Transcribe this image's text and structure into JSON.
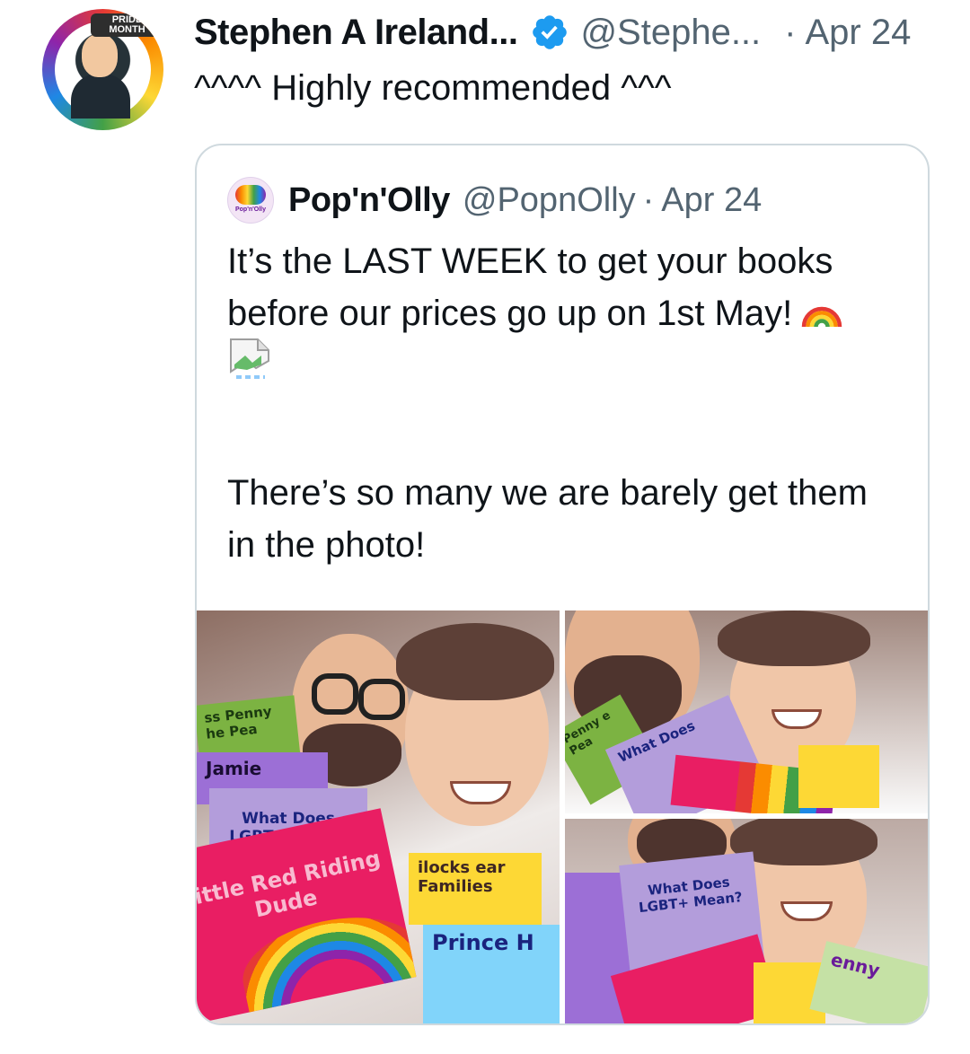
{
  "tweet": {
    "author_name": "Stephen A Ireland...",
    "author_handle": "@Stephe...",
    "separator": "·",
    "date": "Apr 24",
    "text": "^^^^ Highly recommended ^^^",
    "avatar_tag": "PRIDE MONTH"
  },
  "quoted_tweet": {
    "author_name": "Pop'n'Olly",
    "author_handle": "@PopnOlly",
    "separator": "·",
    "date": "Apr 24",
    "avatar_label": "Pop'n'Olly",
    "text_line1": "It’s the LAST WEEK to get your books",
    "text_line2": "before our prices go up on 1st May!",
    "text_line3": "There’s so many we are barely get them",
    "text_line4": "in the photo!",
    "emoji": "rainbow-icon"
  },
  "media": {
    "books": {
      "b1": "ss Penny\nhe Pea",
      "b2": "Jamie",
      "b3": "What Does LGBT+ Mean?",
      "b4": "Little Red Riding Dude",
      "b5": "ilocks ear Families",
      "b6": "Prince H",
      "b7": "Penny e Pea",
      "b8": "What Does",
      "b9": "What Does LGBT+ Mean?",
      "b10": "enny"
    }
  }
}
